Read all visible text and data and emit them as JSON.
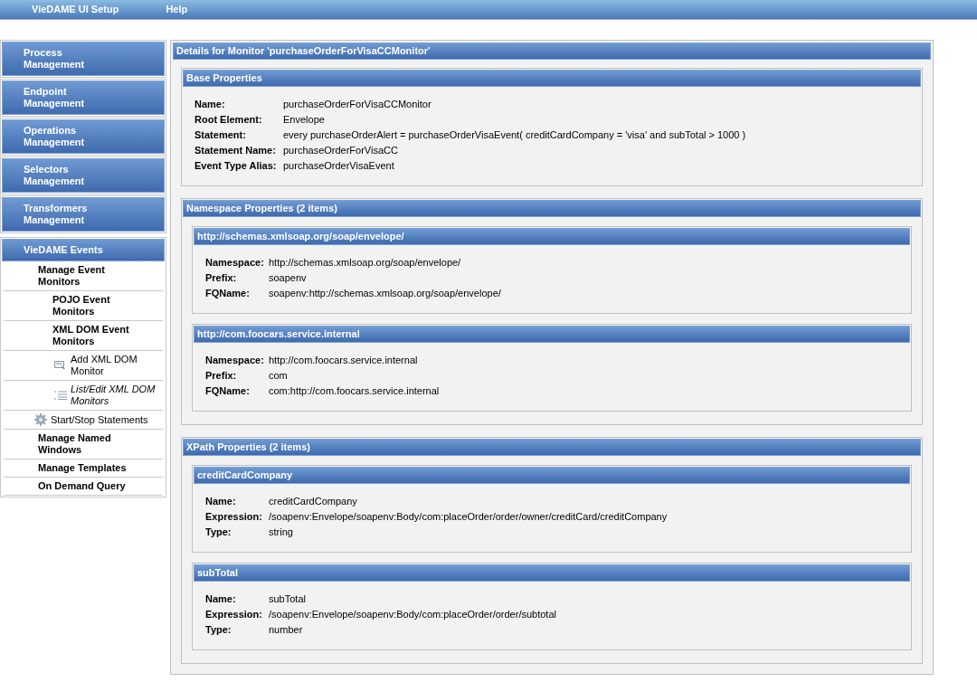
{
  "menu_bar": [
    "VieDAME UI Setup",
    "Help"
  ],
  "sidebar": {
    "sections": [
      {
        "label": "Process Management"
      },
      {
        "label": "Endpoint Management"
      },
      {
        "label": "Operations Management"
      },
      {
        "label": "Selectors Management"
      },
      {
        "label": "Transformers Management"
      },
      {
        "label": "VieDAME Events",
        "items": [
          {
            "label": "Manage Event Monitors",
            "kind": "group",
            "selected": false,
            "children": [
              {
                "label": "POJO Event Monitors",
                "kind": "group",
                "selected": false
              },
              {
                "label": "XML DOM Event Monitors",
                "kind": "group",
                "selected": false,
                "children": [
                  {
                    "label": "Add XML DOM Monitor",
                    "kind": "add",
                    "selected": false
                  },
                  {
                    "label": "List/Edit XML DOM Monitors",
                    "kind": "list",
                    "selected": true
                  }
                ]
              }
            ]
          },
          {
            "label": "Start/Stop Statements",
            "kind": "gear",
            "selected": false
          },
          {
            "label": "Manage Named Windows",
            "kind": "group",
            "selected": false
          },
          {
            "label": "Manage Templates",
            "kind": "group",
            "selected": false
          },
          {
            "label": "On Demand Query",
            "kind": "group",
            "selected": false
          }
        ]
      }
    ]
  },
  "details": {
    "title": "Details for Monitor 'purchaseOrderForVisaCCMonitor'",
    "sections": [
      {
        "title": "Base Properties",
        "fields": [
          {
            "label": "Name:",
            "value": "purchaseOrderForVisaCCMonitor"
          },
          {
            "label": "Root Element:",
            "value": "Envelope"
          },
          {
            "label": "Statement:",
            "value": "every purchaseOrderAlert = purchaseOrderVisaEvent( creditCardCompany = 'visa' and subTotal > 1000 )"
          },
          {
            "label": "Statement Name:",
            "value": "purchaseOrderForVisaCC"
          },
          {
            "label": "Event Type Alias:",
            "value": "purchaseOrderVisaEvent"
          }
        ]
      },
      {
        "title": "Namespace Properties (2 items)",
        "groups": [
          {
            "title": "http://schemas.xmlsoap.org/soap/envelope/",
            "fields": [
              {
                "label": "Namespace:",
                "value": "http://schemas.xmlsoap.org/soap/envelope/"
              },
              {
                "label": "Prefix:",
                "value": "soapenv"
              },
              {
                "label": "FQName:",
                "value": "soapenv:http://schemas.xmlsoap.org/soap/envelope/"
              }
            ]
          },
          {
            "title": "http://com.foocars.service.internal",
            "fields": [
              {
                "label": "Namespace:",
                "value": "http://com.foocars.service.internal"
              },
              {
                "label": "Prefix:",
                "value": "com"
              },
              {
                "label": "FQName:",
                "value": "com:http://com.foocars.service.internal"
              }
            ]
          }
        ]
      },
      {
        "title": "XPath Properties (2 items)",
        "groups": [
          {
            "title": "creditCardCompany",
            "fields": [
              {
                "label": "Name:",
                "value": "creditCardCompany"
              },
              {
                "label": "Expression:",
                "value": "/soapenv:Envelope/soapenv:Body/com:placeOrder/order/owner/creditCard/creditCompany"
              },
              {
                "label": "Type:",
                "value": "string"
              }
            ]
          },
          {
            "title": "subTotal",
            "fields": [
              {
                "label": "Name:",
                "value": "subTotal"
              },
              {
                "label": "Expression:",
                "value": "/soapenv:Envelope/soapenv:Body/com:placeOrder/order/subtotal"
              },
              {
                "label": "Type:",
                "value": "number"
              }
            ]
          }
        ]
      }
    ]
  }
}
